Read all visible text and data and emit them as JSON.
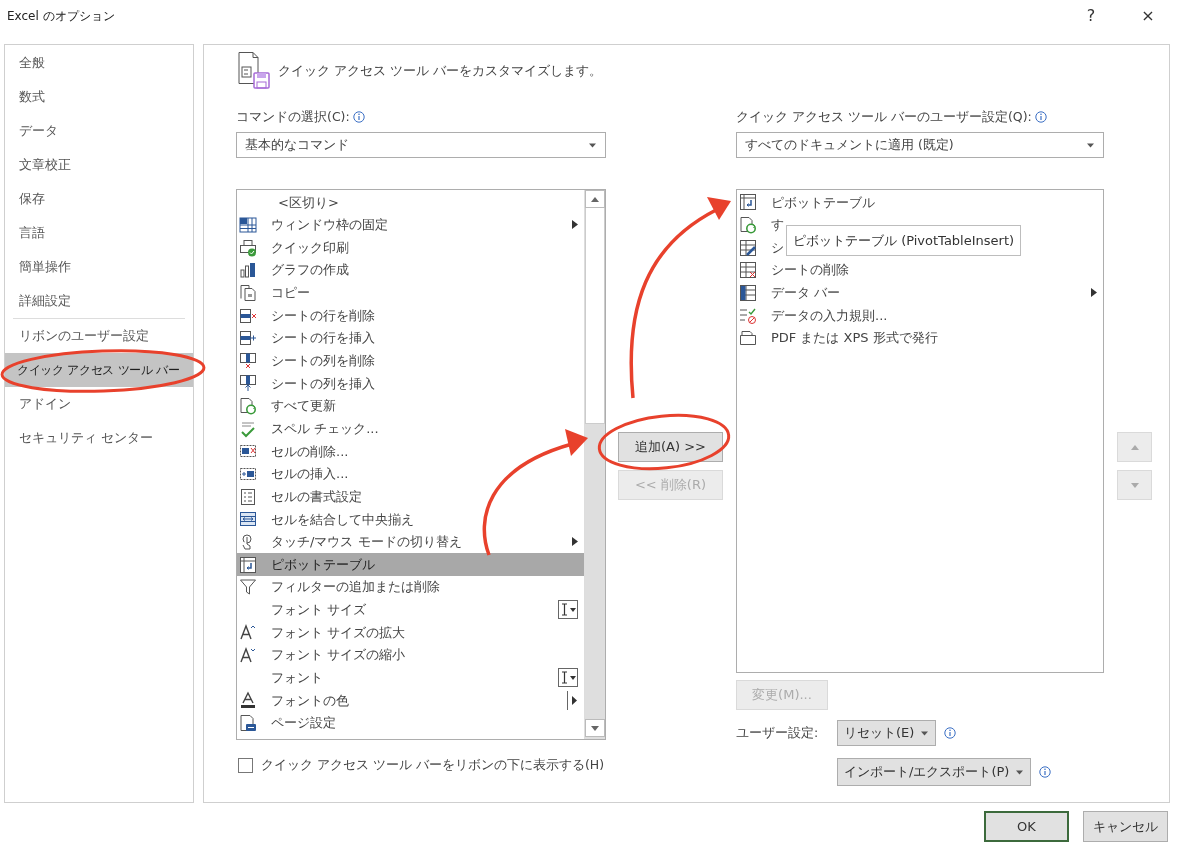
{
  "window": {
    "title": "Excel のオプション",
    "help": "?",
    "close": "×"
  },
  "sidebar": {
    "groups": [
      {
        "items": [
          {
            "label": "全般",
            "selected": false
          },
          {
            "label": "数式",
            "selected": false
          },
          {
            "label": "データ",
            "selected": false
          },
          {
            "label": "文章校正",
            "selected": false
          },
          {
            "label": "保存",
            "selected": false
          },
          {
            "label": "言語",
            "selected": false
          },
          {
            "label": "簡単操作",
            "selected": false
          },
          {
            "label": "詳細設定",
            "selected": false
          }
        ]
      },
      {
        "items": [
          {
            "label": "リボンのユーザー設定",
            "selected": false
          },
          {
            "label": "クイック アクセス ツール バー",
            "selected": true
          },
          {
            "label": "アドイン",
            "selected": false
          },
          {
            "label": "セキュリティ センター",
            "selected": false
          }
        ]
      }
    ]
  },
  "header": {
    "title": "クイック アクセス ツール バーをカスタマイズします。"
  },
  "commands": {
    "label": "コマンドの選択(C):",
    "dropdown": {
      "value": "基本的なコマンド"
    },
    "items": [
      {
        "label": "<区切り>",
        "kind": "separator",
        "selected": false
      },
      {
        "label": "ウィンドウ枠の固定",
        "kind": "submenu",
        "selected": false
      },
      {
        "label": "クイック印刷",
        "kind": "command",
        "selected": false
      },
      {
        "label": "グラフの作成",
        "kind": "command",
        "selected": false
      },
      {
        "label": "コピー",
        "kind": "command",
        "selected": false
      },
      {
        "label": "シートの行を削除",
        "kind": "command",
        "selected": false
      },
      {
        "label": "シートの行を挿入",
        "kind": "command",
        "selected": false
      },
      {
        "label": "シートの列を削除",
        "kind": "command",
        "selected": false
      },
      {
        "label": "シートの列を挿入",
        "kind": "command",
        "selected": false
      },
      {
        "label": "すべて更新",
        "kind": "command",
        "selected": false
      },
      {
        "label": "スペル チェック...",
        "kind": "command",
        "selected": false
      },
      {
        "label": "セルの削除...",
        "kind": "command",
        "selected": false
      },
      {
        "label": "セルの挿入...",
        "kind": "command",
        "selected": false
      },
      {
        "label": "セルの書式設定",
        "kind": "command",
        "selected": false
      },
      {
        "label": "セルを結合して中央揃え",
        "kind": "command",
        "selected": false
      },
      {
        "label": "タッチ/マウス モードの切り替え",
        "kind": "submenu",
        "selected": false
      },
      {
        "label": "ピボットテーブル",
        "kind": "command",
        "selected": true
      },
      {
        "label": "フィルターの追加または削除",
        "kind": "command",
        "selected": false
      },
      {
        "label": "フォント サイズ",
        "kind": "combo",
        "selected": false
      },
      {
        "label": "フォント サイズの拡大",
        "kind": "command",
        "selected": false
      },
      {
        "label": "フォント サイズの縮小",
        "kind": "command",
        "selected": false
      },
      {
        "label": "フォント",
        "kind": "combo",
        "selected": false
      },
      {
        "label": "フォントの色",
        "kind": "split",
        "selected": false
      },
      {
        "label": "ページ設定",
        "kind": "command",
        "selected": false
      }
    ]
  },
  "transfer_buttons": [
    {
      "label": "追加(A) >>",
      "disabled": false
    },
    {
      "label": "<< 削除(R)",
      "disabled": true
    }
  ],
  "show_below_ribbon": {
    "label": "クイック アクセス ツール バーをリボンの下に表示する(H)",
    "checked": false
  },
  "toolbar": {
    "label": "クイック アクセス ツール バーのユーザー設定(Q):",
    "dropdown": {
      "value": "すべてのドキュメントに適用 (既定)"
    },
    "items": [
      {
        "label": "ピボットテーブル",
        "kind": "command",
        "selected": false
      },
      {
        "label": "す",
        "kind": "command",
        "selected": false
      },
      {
        "label": "シ",
        "kind": "command",
        "selected": false
      },
      {
        "label": "シートの削除",
        "kind": "command",
        "selected": false
      },
      {
        "label": "データ バー",
        "kind": "submenu",
        "selected": false
      },
      {
        "label": "データの入力規則...",
        "kind": "command",
        "selected": false
      },
      {
        "label": "PDF または XPS 形式で発行",
        "kind": "command",
        "selected": false
      }
    ],
    "tooltip": "ピボットテーブル (PivotTableInsert)"
  },
  "move_buttons": [
    {
      "disabled": true
    },
    {
      "disabled": true
    }
  ],
  "modify_button": {
    "label": "変更(M)...",
    "disabled": true
  },
  "customizations": {
    "label": "ユーザー設定:",
    "buttons": [
      {
        "label": "リセット(E)"
      },
      {
        "label": "インポート/エクスポート(P)"
      }
    ]
  },
  "footer_buttons": [
    {
      "label": "OK",
      "default": true
    },
    {
      "label": "キャンセル",
      "default": false
    }
  ]
}
